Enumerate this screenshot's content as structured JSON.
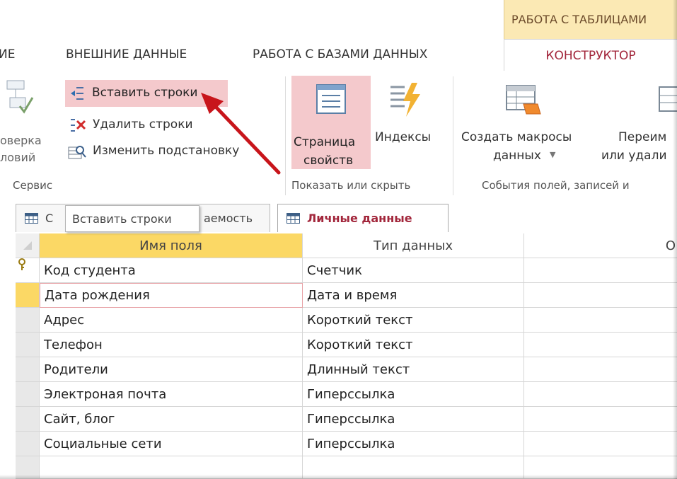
{
  "ribbon": {
    "context_label": "РАБОТА С ТАБЛИЦАМИ",
    "tabs": [
      {
        "label": "ИЕ"
      },
      {
        "label": "ВНЕШНИЕ ДАННЫЕ"
      },
      {
        "label": "РАБОТА С БАЗАМИ ДАННЫХ"
      },
      {
        "label": "КОНСТРУКТОР"
      }
    ],
    "service": {
      "check_label_1": "оверка",
      "check_label_2": "ловий",
      "insert_rows": "Вставить строки",
      "delete_rows": "Удалить строки",
      "modify_lookup": "Изменить подстановку",
      "group_label": "Сервис"
    },
    "show_hide": {
      "property_sheet_1": "Страница",
      "property_sheet_2": "свойств",
      "indexes": "Индексы",
      "group_label": "Показать или скрыть"
    },
    "events": {
      "create_macros_1": "Создать макросы",
      "create_macros_2": "данных",
      "rename_1": "Переим",
      "rename_2": "или удали",
      "group_label": "События полей, записей и"
    }
  },
  "doc_tabs": [
    {
      "label_a": "С",
      "label_b": "аемость"
    },
    {
      "label": "Личные данные"
    }
  ],
  "tooltip": "Вставить строки",
  "grid": {
    "headers": [
      "Имя поля",
      "Тип данных",
      "О"
    ],
    "rows": [
      {
        "field": "Код студента",
        "type": "Счетчик"
      },
      {
        "field": "Дата рождения",
        "type": "Дата и время"
      },
      {
        "field": "Адрес",
        "type": "Короткий текст"
      },
      {
        "field": "Телефон",
        "type": "Короткий текст"
      },
      {
        "field": "Родители",
        "type": "Длинный текст"
      },
      {
        "field": "Электроная почта",
        "type": "Гиперссылка"
      },
      {
        "field": "Сайт, блог",
        "type": "Гиперссылка"
      },
      {
        "field": "Социальные сети",
        "type": "Гиперссылка"
      }
    ]
  },
  "colors": {
    "accent": "#a2263b",
    "highlight": "#f4c9cc",
    "header_yellow": "#fbd865",
    "arrow_red": "#c8151b"
  }
}
